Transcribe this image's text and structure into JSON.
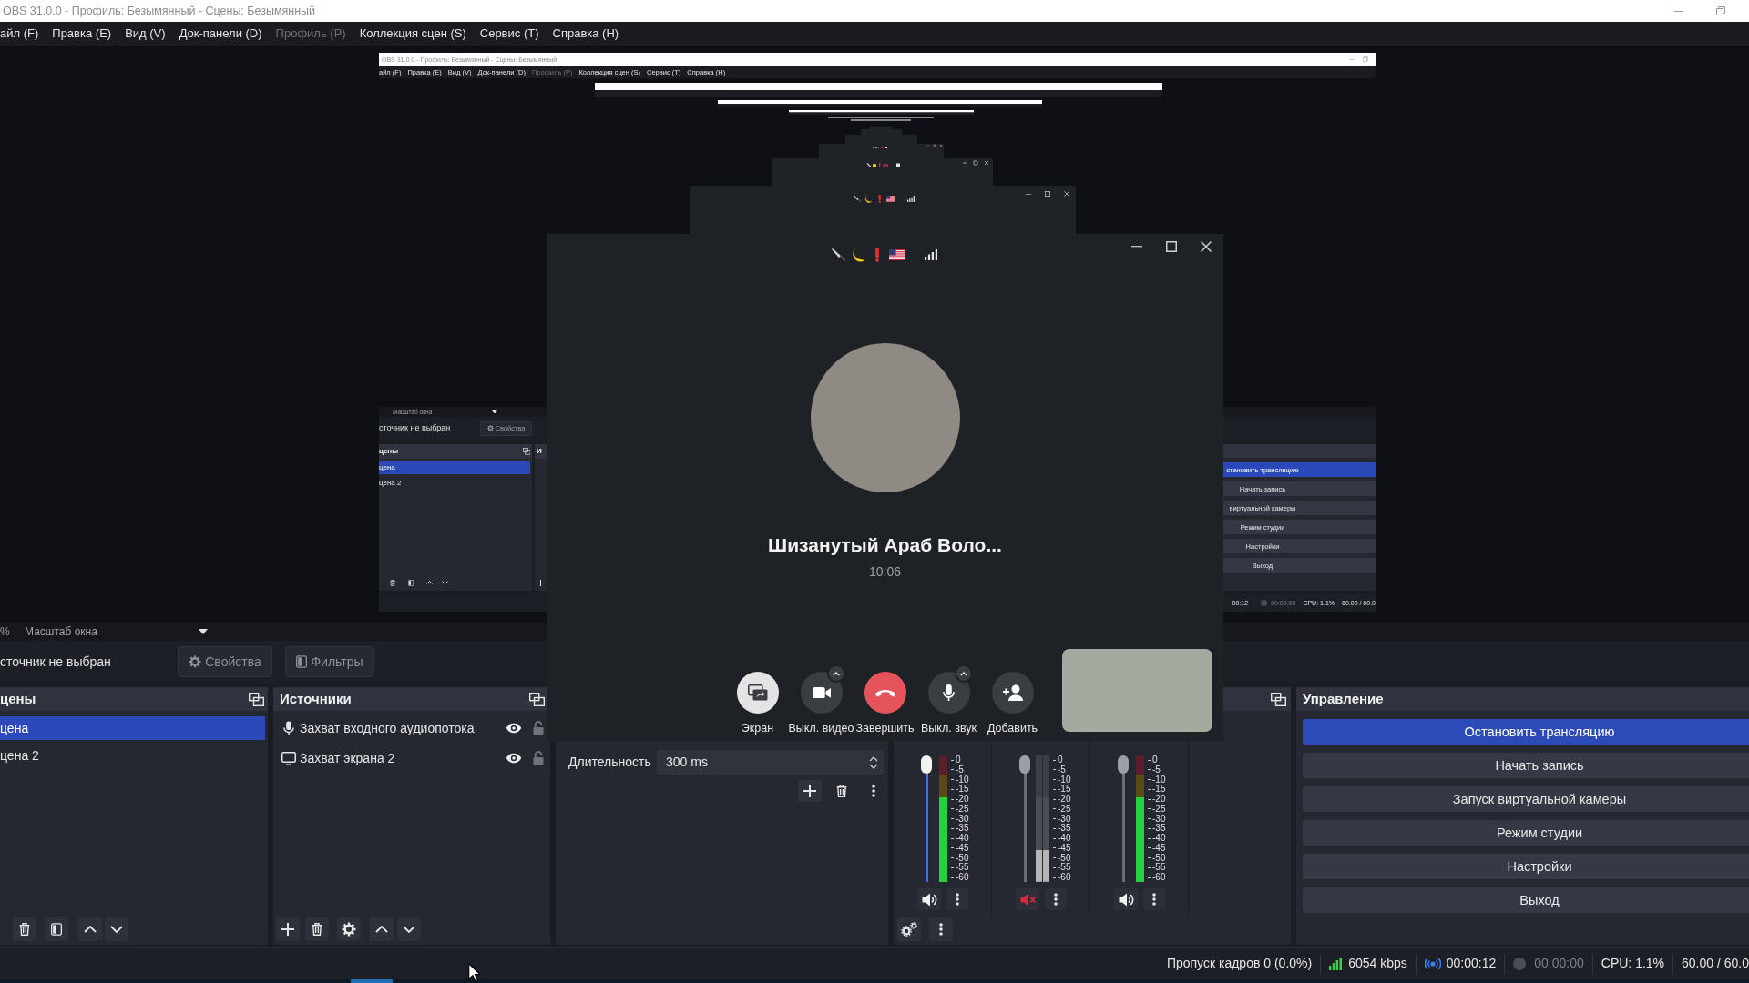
{
  "window": {
    "title": "OBS 31.0.0 - Профиль: Безымянный - Сцены: Безымянный"
  },
  "menu": [
    {
      "label": "айл (F)",
      "disabled": false
    },
    {
      "label": "Правка (E)",
      "disabled": false
    },
    {
      "label": "Вид (V)",
      "disabled": false
    },
    {
      "label": "Док-панели (D)",
      "disabled": false
    },
    {
      "label": "Профиль (P)",
      "disabled": true
    },
    {
      "label": "Коллекция сцен (S)",
      "disabled": false
    },
    {
      "label": "Сервис (T)",
      "disabled": false
    },
    {
      "label": "Справка (H)",
      "disabled": false
    }
  ],
  "preview": {
    "capture": {
      "title": "OBS 31.0.0 - Профиль: Безымянный - Сцены: Безымянный",
      "menu": [
        {
          "label": "айл (F)",
          "disabled": false
        },
        {
          "label": "Правка (E)",
          "disabled": false
        },
        {
          "label": "Вид (V)",
          "disabled": false
        },
        {
          "label": "Док-панели (D)",
          "disabled": false
        },
        {
          "label": "Профиль (P)",
          "disabled": true
        },
        {
          "label": "Коллекция сцен (S)",
          "disabled": false
        },
        {
          "label": "Сервис (T)",
          "disabled": false
        },
        {
          "label": "Справка (H)",
          "disabled": false
        }
      ],
      "zoom_label": "Масштаб окна",
      "source_status": "сточник не выбран",
      "properties_button": "Свойства",
      "scenes_title": "цены",
      "sources_title": "И",
      "scenes": [
        {
          "name": "цена",
          "selected": true
        },
        {
          "name": "цена 2",
          "selected": false
        }
      ],
      "controls": [
        {
          "label": "становить трансляцию",
          "active": true
        },
        {
          "label": "Начать запись",
          "active": false
        },
        {
          "label": "виртуальной камеры",
          "active": false
        },
        {
          "label": "Режим студии",
          "active": false
        },
        {
          "label": "Настройки",
          "active": false
        },
        {
          "label": "Выход",
          "active": false
        }
      ],
      "status_bar": {
        "stream_time": "00:12",
        "recording": {
          "time": "00:00:00",
          "active": false
        },
        "cpu": "CPU: 1.1%",
        "fps": "60.00 / 60.0"
      }
    }
  },
  "zoom_bar": {
    "percent": "%",
    "label": "Масштаб окна"
  },
  "source_toolbar": {
    "status": "сточник не выбран",
    "buttons": [
      {
        "kind": "properties",
        "label": "Свойства",
        "disabled": true
      },
      {
        "kind": "filters",
        "label": "Фильтры",
        "disabled": true
      }
    ]
  },
  "scenes": {
    "title": "цены",
    "items": [
      {
        "name": "цена",
        "selected": true
      },
      {
        "name": "цена 2",
        "selected": false
      }
    ]
  },
  "sources": {
    "title": "Источники",
    "items": [
      {
        "kind": "audio",
        "name": "Захват входного аудиопотока",
        "visible": true,
        "locked": false
      },
      {
        "kind": "display",
        "name": "Захват экрана 2",
        "visible": true,
        "locked": false
      }
    ]
  },
  "transitions": {
    "duration_label": "Длительность",
    "duration_value": "300 ms"
  },
  "mixer": {
    "channels": [
      {
        "kind": "mono",
        "focused": true,
        "muted": false,
        "fader": {
          "level": 1
        },
        "meter": {
          "level": 0.67
        },
        "scale": [
          "0",
          "-5",
          "-10",
          "-15",
          "-20",
          "-25",
          "-30",
          "-35",
          "-40",
          "-45",
          "-50",
          "-55",
          "-60"
        ]
      },
      {
        "kind": "stereo",
        "focused": false,
        "muted": true,
        "fader": {
          "level": 1
        },
        "meter": {
          "level": 0.25
        },
        "scale": [
          "0",
          "-5",
          "-10",
          "-15",
          "-20",
          "-25",
          "-30",
          "-35",
          "-40",
          "-45",
          "-50",
          "-55",
          "-60"
        ]
      },
      {
        "kind": "mono",
        "focused": false,
        "muted": false,
        "fader": {
          "level": 1
        },
        "meter": {
          "level": 0.67
        },
        "scale": [
          "0",
          "-5",
          "-10",
          "-15",
          "-20",
          "-25",
          "-30",
          "-35",
          "-40",
          "-45",
          "-50",
          "-55",
          "-60"
        ]
      }
    ]
  },
  "controls": {
    "title": "Управление",
    "buttons": [
      {
        "label": "Остановить трансляцию",
        "active": true
      },
      {
        "label": "Начать запись",
        "active": false
      },
      {
        "label": "Запуск виртуальной камеры",
        "active": false
      },
      {
        "label": "Режим студии",
        "active": false
      },
      {
        "label": "Настройки",
        "active": false
      },
      {
        "label": "Выход",
        "active": false
      }
    ]
  },
  "status_bar": {
    "dropped_frames": "Пропуск кадров 0 (0.0%)",
    "bitrate": "6054 kbps",
    "streaming": {
      "time": "00:00:12",
      "active": true
    },
    "recording": {
      "time": "00:00:00",
      "active": false
    },
    "cpu": "CPU: 1.1%",
    "fps": "60.00 / 60.0"
  },
  "call": {
    "caller": "Шизанутый Араб Воло...",
    "duration": "10:06",
    "buttons": [
      {
        "kind": "screen",
        "label": "Экран",
        "has_menu": false
      },
      {
        "kind": "video",
        "label": "Выкл. видео",
        "has_menu": true
      },
      {
        "kind": "end",
        "label": "Завершить",
        "has_menu": false
      },
      {
        "kind": "mic",
        "label": "Выкл. звук",
        "has_menu": true
      },
      {
        "kind": "add",
        "label": "Добавить",
        "has_menu": false
      }
    ]
  }
}
